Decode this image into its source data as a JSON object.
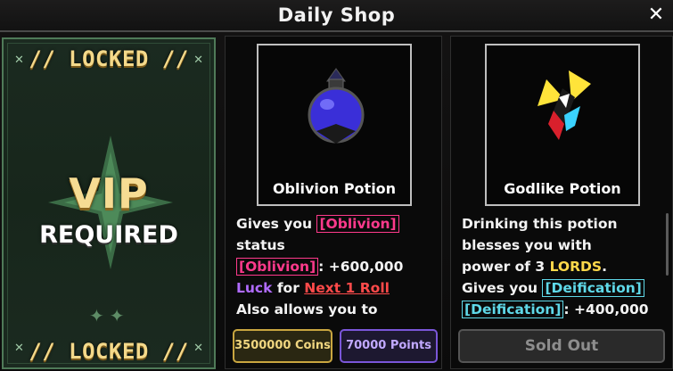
{
  "window": {
    "title": "Daily Shop",
    "close_glyph": "✕"
  },
  "vip_panel": {
    "locked_label": "// LOCKED //",
    "vip_label": "VIP",
    "required_label": "REQUIRED",
    "sparkles": "✦✦",
    "corner_glyph": "✕",
    "star_icon": "four-point-star-icon"
  },
  "items": [
    {
      "name": "Oblivion Potion",
      "icon": "oblivion-potion-icon",
      "description": {
        "line1_prefix": "Gives you ",
        "line1_tag": "[Oblivion]",
        "line2": "status",
        "line3_tag": "[Oblivion]",
        "line3_suffix": ": +600,000",
        "line4_luck": "Luck",
        "line4_mid": " for ",
        "line4_roll": "Next 1 Roll",
        "line5": "Also allows you to"
      },
      "price_coins": "3500000 Coins",
      "price_points": "70000 Points"
    },
    {
      "name": "Godlike Potion",
      "icon": "godlike-potion-icon",
      "description": {
        "line1": "Drinking this potion",
        "line2": "blesses you with",
        "line3_prefix": "power of 3 ",
        "line3_lords": "LORDS",
        "line3_suffix": ".",
        "line4_prefix": "Gives you ",
        "line4_tag": "[Deification]",
        "line5_tag": "[Deification]",
        "line5_suffix": ": +400,000"
      },
      "status_label": "Sold Out"
    }
  ],
  "colors": {
    "oblivion_tag": "#ff3a8c",
    "deification_tag": "#5fd8e8",
    "luck": "#b06bff",
    "next_roll": "#ff4a4a",
    "lords": "#ffd84a",
    "vip_gold": "#f6dc93",
    "vip_panel_bg": "#1b2a20"
  }
}
